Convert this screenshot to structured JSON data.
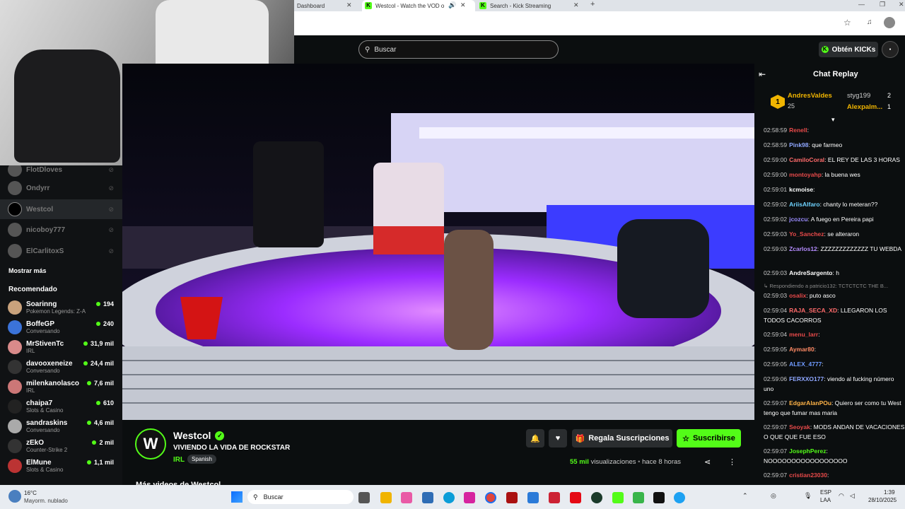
{
  "browser": {
    "tabs": [
      {
        "label": "Dashboard"
      },
      {
        "label": "Westcol - Watch the VOD o"
      },
      {
        "label": "Search - Kick Streaming"
      }
    ],
    "new_tab": "+"
  },
  "kick": {
    "search_placeholder": "Buscar",
    "kicks_button": "Obtén KICKs"
  },
  "sidebar": {
    "following": [
      {
        "name": "FlotDloves",
        "live": false
      },
      {
        "name": "Ondyrr",
        "live": false
      },
      {
        "name": "Westcol",
        "live": false,
        "selected": true
      },
      {
        "name": "nicoboy777",
        "live": false
      },
      {
        "name": "ElCarlitoxS",
        "live": false
      }
    ],
    "show_more": "Mostrar más",
    "recommended_title": "Recomendado",
    "recommended": [
      {
        "name": "Soarinng",
        "category": "Pokemon Legends: Z-A",
        "viewers": "194",
        "color": "#c9a27c"
      },
      {
        "name": "BoffeGP",
        "category": "Conversando",
        "viewers": "240",
        "color": "#3b73d9"
      },
      {
        "name": "MrStivenTc",
        "category": "IRL",
        "viewers": "31,9 mil",
        "color": "#d98a8a"
      },
      {
        "name": "davooxeneize",
        "category": "Conversando",
        "viewers": "24,4 mil",
        "color": "#333"
      },
      {
        "name": "milenkanolasco",
        "category": "IRL",
        "viewers": "7,6 mil",
        "color": "#c77"
      },
      {
        "name": "chaipa7",
        "category": "Slots & Casino",
        "viewers": "610",
        "color": "#222"
      },
      {
        "name": "sandraskins",
        "category": "Conversando",
        "viewers": "4,6 mil",
        "color": "#aaa"
      },
      {
        "name": "zEkO",
        "category": "Counter-Strike 2",
        "viewers": "2 mil",
        "color": "#333"
      },
      {
        "name": "ElMune",
        "category": "Slots & Casino",
        "viewers": "1,1 mil",
        "color": "#b33"
      }
    ]
  },
  "stream": {
    "channel": "Westcol",
    "title": "VIVIENDO LA VIDA DE ROCKSTAR",
    "category": "IRL",
    "language": "Spanish",
    "views_count": "55 mil",
    "views_label": "visualizaciones",
    "age": "hace 8 horas",
    "gift_button": "Regala Suscripciones",
    "subscribe_button": "Suscribirse",
    "more_videos": "Más videos de Westcol"
  },
  "chat": {
    "title": "Chat Replay",
    "leaderboard": [
      {
        "rank": "1",
        "name": "AndresValdes",
        "count": "25"
      },
      {
        "name": "styg199",
        "count": "2"
      },
      {
        "name": "Alexpalm...",
        "count": "1"
      }
    ],
    "messages": [
      {
        "time": "02:58:59",
        "user": "Renell",
        "color": "#e84a4a",
        "text": ":"
      },
      {
        "time": "02:58:59",
        "user": "Pink98",
        "color": "#8fa7ff",
        "text": ": que farmeo"
      },
      {
        "time": "02:59:00",
        "user": "CamiloCoral",
        "color": "#ff6b6b",
        "text": ": EL REY DE LAS 3 HORAS"
      },
      {
        "time": "02:59:00",
        "user": "montoyahp",
        "color": "#e84a4a",
        "text": ": la buena wes"
      },
      {
        "time": "02:59:01",
        "user": "kcmoise",
        "color": "#ffffff",
        "text": ":"
      },
      {
        "time": "02:59:02",
        "user": "AriisAlfaro",
        "color": "#6fd3ff",
        "text": ": chanty lo meteran??"
      },
      {
        "time": "02:59:02",
        "user": "jcozcu",
        "color": "#9b8cff",
        "text": ": A fuego en Pereira papi"
      },
      {
        "time": "02:59:03",
        "user": "Yo_Sanchez",
        "color": "#e84a4a",
        "text": ": se alteraron"
      },
      {
        "time": "02:59:03",
        "user": "Zcarlos12",
        "color": "#b58cff",
        "text": ": ZZZZZZZZZZZZZ TU WEBDA"
      },
      {
        "time": "02:59:03",
        "user": "AndreSargento",
        "color": "#ffffff",
        "text": ": h"
      },
      {
        "time": "",
        "user": "",
        "color": "#888",
        "text": "Respondiendo a patricio132: TCTCTCTC THE B..."
      },
      {
        "time": "02:59:03",
        "user": "osalix",
        "color": "#e84a4a",
        "text": ": puto asco"
      },
      {
        "time": "02:59:04",
        "user": "RAJA_SECA_XD",
        "color": "#ff6b6b",
        "text": ": LLEGARON LOS TODOS CACORROS"
      },
      {
        "time": "02:59:04",
        "user": "menu_larr",
        "color": "#e84a4a",
        "text": ":"
      },
      {
        "time": "02:59:05",
        "user": "Aymar80",
        "color": "#ff8a65",
        "text": ":"
      },
      {
        "time": "02:59:05",
        "user": "ALEX_4777",
        "color": "#6f9bff",
        "text": ":"
      },
      {
        "time": "02:59:06",
        "user": "FERXXO177",
        "color": "#8fa7ff",
        "text": ": viendo al fucking número uno"
      },
      {
        "time": "02:59:07",
        "user": "EdgarAlanPOu",
        "color": "#ffb347",
        "text": ": Quiero ser como tu West tengo que fumar mas maria"
      },
      {
        "time": "02:59:07",
        "user": "Seoyak",
        "color": "#e84a4a",
        "text": ": MODS ANDAN DE VACACIONES O QUE QUE FUE ESO"
      },
      {
        "time": "02:59:07",
        "user": "JosephPerez",
        "color": "#53fc18",
        "text": ": NOOOOOOOOOOOOOOOOO"
      },
      {
        "time": "02:59:07",
        "user": "cristian23030",
        "color": "#e84a4a",
        "text": ":"
      }
    ]
  },
  "taskbar": {
    "weather_temp": "16°C",
    "weather_desc": "Mayorm. nublado",
    "search": "Buscar",
    "lang1": "ESP",
    "lang2": "LAA",
    "time": "1:39",
    "date": "28/10/2025"
  }
}
